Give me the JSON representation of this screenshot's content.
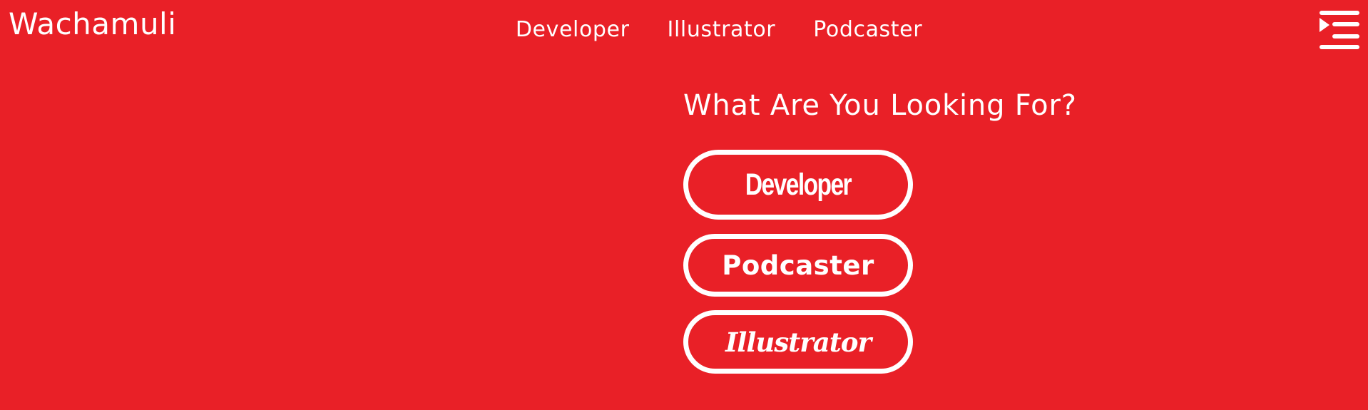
{
  "header": {
    "brand": "Wachamuli",
    "nav": [
      {
        "label": "Developer"
      },
      {
        "label": "Illustrator"
      },
      {
        "label": "Podcaster"
      }
    ],
    "menu_icon": "menu-expand-icon"
  },
  "main": {
    "heading": "What Are You Looking For?",
    "choices": [
      {
        "label": "Developer"
      },
      {
        "label": "Podcaster"
      },
      {
        "label": "Illustrator"
      }
    ]
  },
  "colors": {
    "background": "#e92027",
    "foreground": "#ffffff"
  }
}
